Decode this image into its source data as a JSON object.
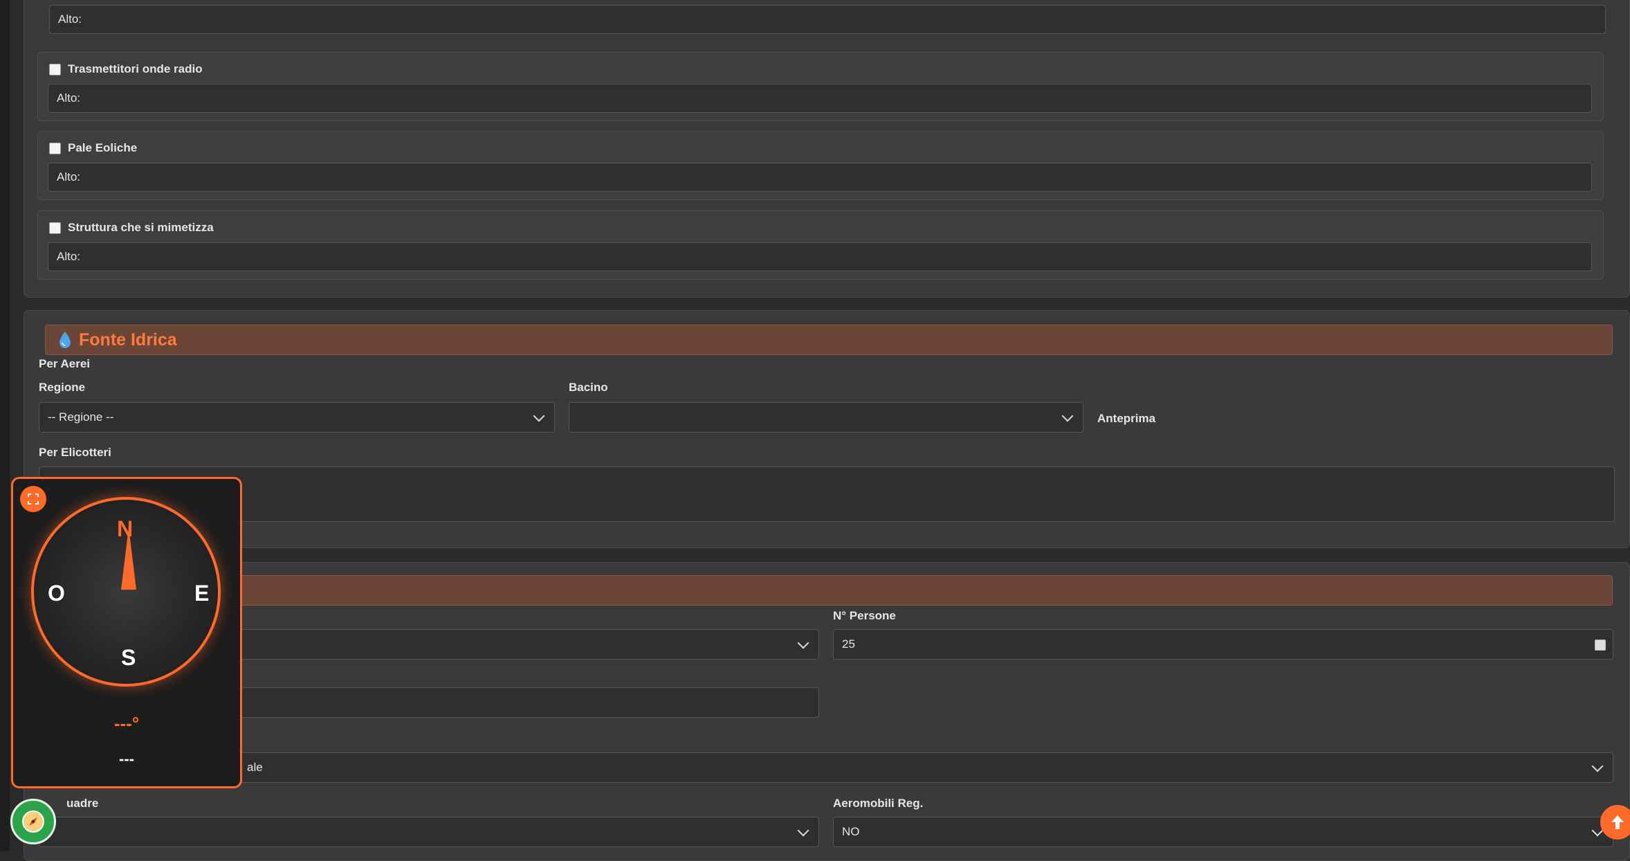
{
  "obstacles": {
    "top_partial": {
      "alto_label": "Alto:"
    },
    "items": [
      {
        "label": "Trasmettitori onde radio",
        "alto_label": "Alto:"
      },
      {
        "label": "Pale Eoliche",
        "alto_label": "Alto:"
      },
      {
        "label": "Struttura che si mimetizza",
        "alto_label": "Alto:"
      }
    ]
  },
  "water_source": {
    "title": "Fonte Idrica",
    "icon": "droplet-icon",
    "per_aerei": "Per Aerei",
    "regione_label": "Regione",
    "regione_value": "-- Regione --",
    "bacino_label": "Bacino",
    "bacino_value": "",
    "anteprima": "Anteprima",
    "per_elicotteri": "Per Elicotteri",
    "per_elicotteri_value": ""
  },
  "resources": {
    "persone_label": "N° Persone",
    "persone_value": "25",
    "partial_select_value": "ale",
    "squadre_label": "uadre",
    "aeromobili_label": "Aeromobili Reg.",
    "aeromobili_value": "NO"
  },
  "compass": {
    "n": "N",
    "e": "E",
    "s": "S",
    "o": "O",
    "heading": "---°",
    "status": "---"
  },
  "colors": {
    "accent": "#ff6a2a",
    "banner_bg": "#6a4538",
    "fab_green": "#2aa34a"
  }
}
